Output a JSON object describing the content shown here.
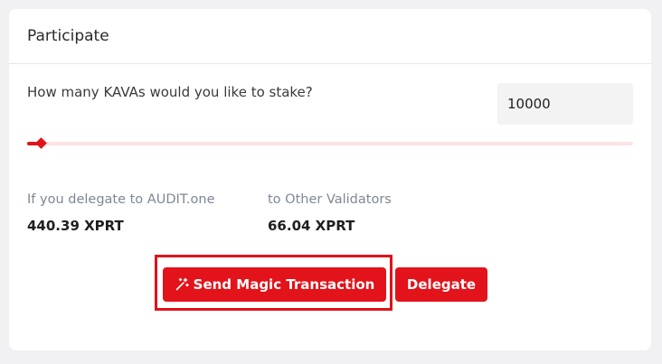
{
  "card": {
    "title": "Participate"
  },
  "stake": {
    "question": "How many KAVAs would you like to stake?",
    "amount_value": "10000",
    "slider_fraction": 0.018
  },
  "rewards": {
    "audit_label": "If you delegate to AUDIT.one",
    "audit_value": "440.39 XPRT",
    "other_label": "to Other Validators",
    "other_value": "66.04 XPRT"
  },
  "actions": {
    "magic_label": "Send Magic Transaction",
    "magic_icon": "magic-wand-icon",
    "delegate_label": "Delegate"
  },
  "colors": {
    "accent": "#e2131a",
    "track": "#fde3e3",
    "muted_text": "#7e8796"
  }
}
